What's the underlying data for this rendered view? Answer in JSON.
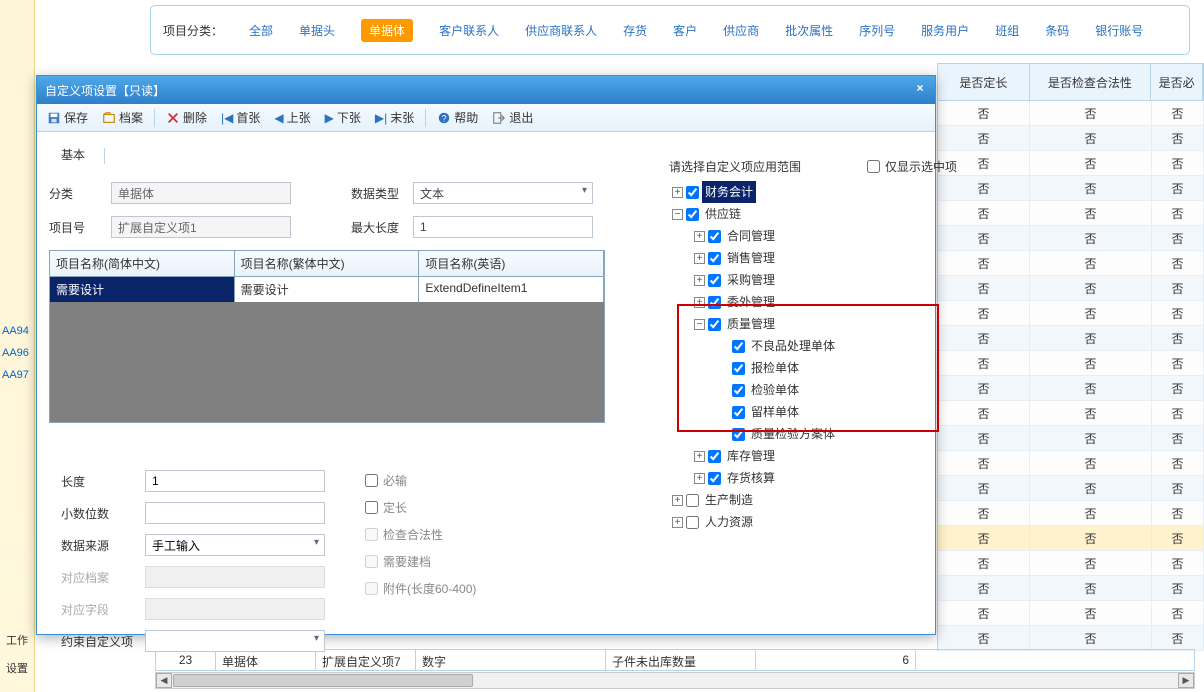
{
  "topFilter": {
    "label": "项目分类：",
    "tabs": [
      "全部",
      "单据头",
      "单据体",
      "客户联系人",
      "供应商联系人",
      "存货",
      "客户",
      "供应商",
      "批次属性",
      "序列号",
      "服务用户",
      "班组",
      "条码",
      "银行账号"
    ],
    "activeIndex": 2
  },
  "bgTable": {
    "headers": [
      "是否定长",
      "是否检查合法性",
      "是否必"
    ],
    "cell": "否",
    "rowCount": 22,
    "highlightRow": 17
  },
  "bgLeftCodes": [
    "AA94",
    "AA96",
    "AA97"
  ],
  "bgSidebar": {
    "item1": "工作",
    "item2": "设置"
  },
  "bgBottomRow": {
    "c0": "23",
    "c1": "单据体",
    "c2": "扩展自定义项7",
    "c3": "数字",
    "c4": "",
    "c5": "子件未出库数量",
    "c6": "6"
  },
  "dialog": {
    "title": "自定义项设置【只读】",
    "toolbar": {
      "save": "保存",
      "archive": "档案",
      "delete": "删除",
      "first": "首张",
      "prev": "上张",
      "next": "下张",
      "last": "末张",
      "help": "帮助",
      "exit": "退出"
    },
    "tabs": {
      "basic": "基本"
    },
    "form": {
      "category_label": "分类",
      "category_value": "单据体",
      "itemno_label": "项目号",
      "itemno_value": "扩展自定义项1",
      "datatype_label": "数据类型",
      "datatype_value": "文本",
      "maxlen_label": "最大长度",
      "maxlen_value": "1"
    },
    "grid": {
      "h1": "项目名称(简体中文)",
      "h2": "项目名称(繁体中文)",
      "h3": "项目名称(英语)",
      "r1c1": "需要设计",
      "r1c2": "需要设计",
      "r1c3": "ExtendDefineItem1"
    },
    "lower": {
      "length_label": "长度",
      "length_value": "1",
      "decimal_label": "小数位数",
      "decimal_value": "",
      "source_label": "数据来源",
      "source_value": "手工输入",
      "refarchive_label": "对应档案",
      "reffield_label": "对应字段",
      "constraint_label": "约束自定义项",
      "cb_required": "必输",
      "cb_fixed": "定长",
      "cb_check": "检查合法性",
      "cb_needarchive": "需要建档",
      "cb_attach": "附件(长度60-400)"
    },
    "treeHeader": {
      "title": "请选择自定义项应用范围",
      "onlyChecked": "仅显示选中项"
    },
    "tree": [
      {
        "id": "fin",
        "indent": 0,
        "toggle": "+",
        "checked": true,
        "label": "财务会计",
        "selected": true
      },
      {
        "id": "supply",
        "indent": 0,
        "toggle": "-",
        "checked": true,
        "label": "供应链"
      },
      {
        "id": "contract",
        "indent": 1,
        "toggle": "+",
        "checked": true,
        "label": "合同管理"
      },
      {
        "id": "sales",
        "indent": 1,
        "toggle": "+",
        "checked": true,
        "label": "销售管理"
      },
      {
        "id": "purchase",
        "indent": 1,
        "toggle": "+",
        "checked": true,
        "label": "采购管理"
      },
      {
        "id": "outsource",
        "indent": 1,
        "toggle": "+",
        "checked": true,
        "label": "委外管理"
      },
      {
        "id": "quality",
        "indent": 1,
        "toggle": "-",
        "checked": true,
        "label": "质量管理"
      },
      {
        "id": "defect",
        "indent": 2,
        "toggle": "",
        "checked": true,
        "label": "不良品处理单体"
      },
      {
        "id": "inspect-req",
        "indent": 2,
        "toggle": "",
        "checked": true,
        "label": "报检单体"
      },
      {
        "id": "inspect",
        "indent": 2,
        "toggle": "",
        "checked": true,
        "label": "检验单体"
      },
      {
        "id": "sample",
        "indent": 2,
        "toggle": "",
        "checked": true,
        "label": "留样单体"
      },
      {
        "id": "qcplan",
        "indent": 2,
        "toggle": "",
        "checked": true,
        "label": "质量检验方案体"
      },
      {
        "id": "warehouse",
        "indent": 1,
        "toggle": "+",
        "checked": true,
        "label": "库存管理"
      },
      {
        "id": "stock",
        "indent": 1,
        "toggle": "+",
        "checked": true,
        "label": "存货核算"
      },
      {
        "id": "mfg",
        "indent": 0,
        "toggle": "+",
        "checked": false,
        "label": "生产制造"
      },
      {
        "id": "hr",
        "indent": 0,
        "toggle": "+",
        "checked": false,
        "label": "人力资源"
      }
    ]
  }
}
